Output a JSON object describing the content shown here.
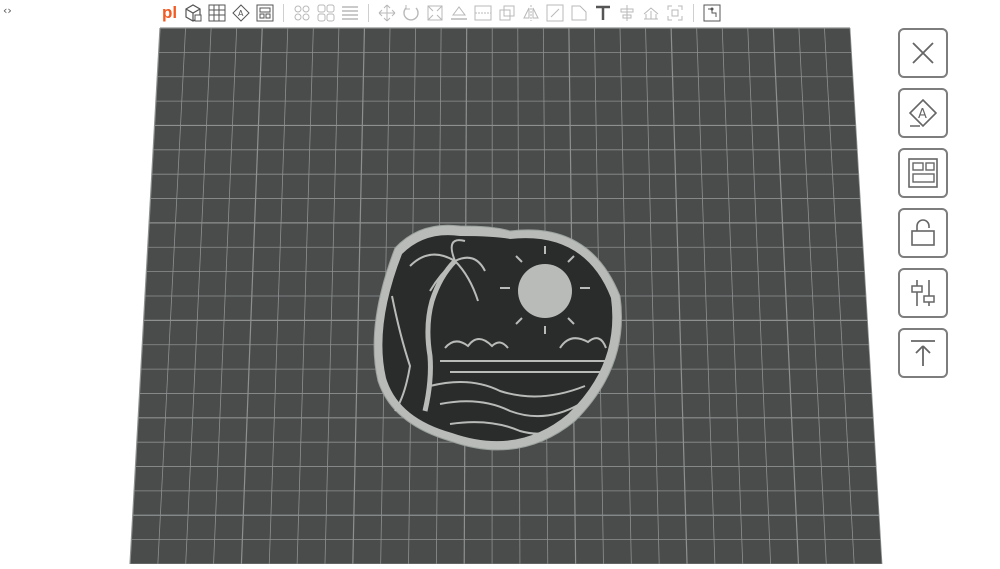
{
  "app": {
    "logo_text": "pl",
    "corner_glyph": "‹›",
    "brand_color": "#f25b22"
  },
  "toolbar": {
    "icons": [
      "add-shape-icon",
      "grid-icon",
      "text-stamp-icon",
      "layout-icon",
      "arrange-icon",
      "pack-icon",
      "list-icon",
      "move-icon",
      "rotate-icon",
      "scale-icon",
      "flatten-icon",
      "split-icon",
      "cut-icon",
      "mirror-icon",
      "hollow-icon",
      "tag-icon",
      "text-icon",
      "align-icon",
      "support-icon",
      "fit-icon",
      "puzzle-icon"
    ]
  },
  "viewport": {
    "plate_color": "#4a4c4c",
    "grid_color": "#8e9090",
    "model_base_color": "#b8bbb8",
    "model_fill_color": "#2a2b2b"
  },
  "side_panel": {
    "buttons": [
      "close-icon",
      "text-stamp-icon",
      "layout-icon",
      "lock-icon",
      "sliders-icon",
      "upload-icon"
    ]
  }
}
